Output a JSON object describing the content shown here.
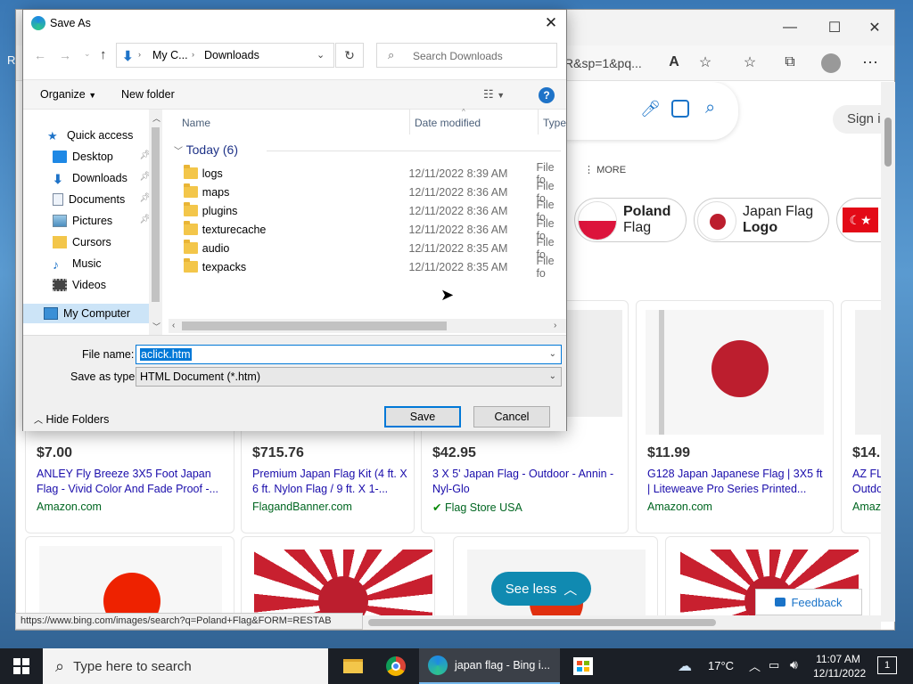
{
  "desktop": {
    "partial_text": "R"
  },
  "browser": {
    "address_fragment": "R&sp=1&pq...",
    "window_controls": [
      "—",
      "☐",
      "✕"
    ],
    "search_tools": {
      "more_label": "MORE",
      "sign_in": "Sign ir"
    },
    "chips": [
      {
        "line1": "Poland",
        "line2": "Flag",
        "bold_line": 1
      },
      {
        "line1": "Japan Flag",
        "line2": "Logo",
        "bold_line": 2
      }
    ],
    "products": [
      {
        "price": "$7.00",
        "title": "ANLEY Fly Breeze 3X5 Foot Japan Flag - Vivid Color And Fade Proof -...",
        "source": "Amazon.com"
      },
      {
        "price": "$715.76",
        "title": "Premium Japan Flag Kit (4 ft. X 6 ft. Nylon Flag / 9 ft. X 1-...",
        "source": "FlagandBanner.com"
      },
      {
        "price": "$42.95",
        "title": "3 X 5' Japan Flag - Outdoor - Annin - Nyl-Glo",
        "source": "Flag Store USA"
      },
      {
        "price": "$11.99",
        "title": "G128 Japan Japanese Flag | 3X5 ft | Liteweave Pro Series Printed...",
        "source": "Amazon.com"
      },
      {
        "price": "$14.",
        "title": "AZ FL Outdo",
        "source": "Amaz"
      }
    ],
    "see_less": "See less",
    "feedback": "Feedback",
    "status_url": "https://www.bing.com/images/search?q=Poland+Flag&FORM=RESTAB"
  },
  "dialog": {
    "title": "Save As",
    "breadcrumb": [
      "My C...",
      "Downloads"
    ],
    "search_placeholder": "Search Downloads",
    "organize": "Organize",
    "new_folder": "New folder",
    "tree": [
      {
        "label": "Quick access",
        "icon": "star-icon",
        "pinned": false
      },
      {
        "label": "Desktop",
        "icon": "desktop-icon",
        "pinned": true
      },
      {
        "label": "Downloads",
        "icon": "download-icon",
        "pinned": true
      },
      {
        "label": "Documents",
        "icon": "documents-icon",
        "pinned": true
      },
      {
        "label": "Pictures",
        "icon": "pictures-icon",
        "pinned": true
      },
      {
        "label": "Cursors",
        "icon": "folder-icon",
        "pinned": false
      },
      {
        "label": "Music",
        "icon": "music-icon",
        "pinned": false
      },
      {
        "label": "Videos",
        "icon": "videos-icon",
        "pinned": false
      },
      {
        "label": "My Computer",
        "icon": "computer-icon",
        "pinned": false
      }
    ],
    "columns": {
      "name": "Name",
      "date": "Date modified",
      "type": "Type"
    },
    "group_label": "Today (6)",
    "files": [
      {
        "name": "logs",
        "date": "12/11/2022 8:39 AM",
        "type": "File fo"
      },
      {
        "name": "maps",
        "date": "12/11/2022 8:36 AM",
        "type": "File fo"
      },
      {
        "name": "plugins",
        "date": "12/11/2022 8:36 AM",
        "type": "File fo"
      },
      {
        "name": "texturecache",
        "date": "12/11/2022 8:36 AM",
        "type": "File fo"
      },
      {
        "name": "audio",
        "date": "12/11/2022 8:35 AM",
        "type": "File fo"
      },
      {
        "name": "texpacks",
        "date": "12/11/2022 8:35 AM",
        "type": "File fo"
      }
    ],
    "file_name_label": "File name:",
    "file_name_value": "aclick.htm",
    "save_type_label": "Save as type:",
    "save_type_value": "HTML Document (*.htm)",
    "hide_folders": "Hide Folders",
    "save": "Save",
    "cancel": "Cancel"
  },
  "taskbar": {
    "search_placeholder": "Type here to search",
    "active_app": "japan flag - Bing i...",
    "weather": "17°C",
    "time": "11:07 AM",
    "date": "12/11/2022",
    "notification_count": "1"
  },
  "colors": {
    "accent": "#0078d7",
    "link": "#1a0dab",
    "flag_red": "#bc1e2e",
    "selection": "#0078d7",
    "see_less_bg": "#108ab1"
  }
}
